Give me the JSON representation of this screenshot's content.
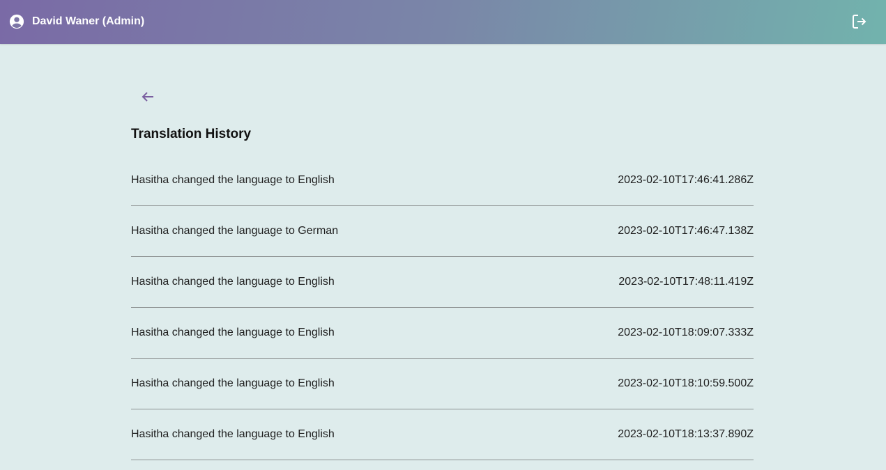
{
  "header": {
    "user_name": "David Waner (Admin)",
    "user_icon": "account-circle-icon",
    "logout_icon": "logout-icon"
  },
  "page": {
    "back_icon": "arrow-left-icon",
    "title": "Translation History"
  },
  "history": [
    {
      "text": "Hasitha changed the language to English",
      "time": "2023-02-10T17:46:41.286Z"
    },
    {
      "text": "Hasitha changed the language to German",
      "time": "2023-02-10T17:46:47.138Z"
    },
    {
      "text": "Hasitha changed the language to English",
      "time": "2023-02-10T17:48:11.419Z"
    },
    {
      "text": "Hasitha changed the language to English",
      "time": "2023-02-10T18:09:07.333Z"
    },
    {
      "text": "Hasitha changed the language to English",
      "time": "2023-02-10T18:10:59.500Z"
    },
    {
      "text": "Hasitha changed the language to English",
      "time": "2023-02-10T18:13:37.890Z"
    }
  ],
  "colors": {
    "header_gradient_start": "#7a6aa6",
    "header_gradient_end": "#72b3ad",
    "background": "#deecec",
    "accent": "#7a5fa0"
  }
}
